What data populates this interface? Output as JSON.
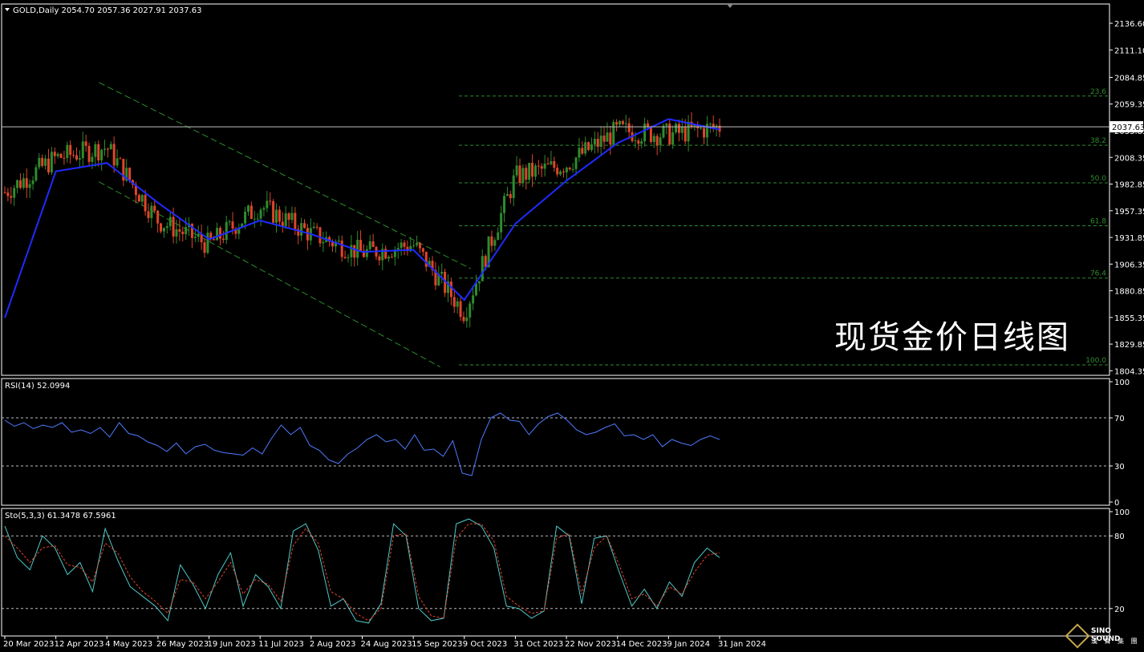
{
  "symbol_header": "GOLD,Daily  2054.70 2057.36 2027.91 2037.63",
  "current_price_label": "2037.63",
  "watermark": "现货金价日线图",
  "logo": {
    "name": "SINO SOUND",
    "sub": "漢 聲 集 團"
  },
  "rsi_header": "RSI(14) 52.0994",
  "sto_header": "Sto(5,3,3) 61.3478 67.5961",
  "chart_data": [
    {
      "type": "candlestick",
      "ylim": [
        1800,
        2155
      ],
      "y_ticks": [
        "2136.60",
        "2111.10",
        "2084.85",
        "2059.35",
        "2033.85",
        "2008.35",
        "1982.85",
        "1957.35",
        "1931.85",
        "1906.35",
        "1880.85",
        "1855.35",
        "1829.85",
        "1804.35"
      ],
      "x_ticks": [
        "20 Mar 2023",
        "12 Apr 2023",
        "4 May 2023",
        "26 May 2023",
        "19 Jun 2023",
        "11 Jul 2023",
        "2 Aug 2023",
        "24 Aug 2023",
        "15 Sep 2023",
        "9 Oct 2023",
        "31 Oct 2023",
        "22 Nov 2023",
        "14 Dec 2023",
        "9 Jan 2024",
        "31 Jan 2024"
      ],
      "close_path": [
        [
          "20 Mar 2023",
          1975
        ],
        [
          "12 Apr 2023",
          2008
        ],
        [
          "4 May 2023",
          2018
        ],
        [
          "26 May 2023",
          1948
        ],
        [
          "19 Jun 2023",
          1925
        ],
        [
          "11 Jul 2023",
          1962
        ],
        [
          "2 Aug 2023",
          1935
        ],
        [
          "24 Aug 2023",
          1917
        ],
        [
          "15 Sep 2023",
          1925
        ],
        [
          "9 Oct 2023",
          1860
        ],
        [
          "31 Oct 2023",
          1990
        ],
        [
          "22 Nov 2023",
          2002
        ],
        [
          "14 Dec 2023",
          2034
        ],
        [
          "9 Jan 2024",
          2030
        ],
        [
          "31 Jan 2024",
          2037.63
        ]
      ],
      "ma_path": [
        [
          "20 Mar 2023",
          1855
        ],
        [
          "12 Apr 2023",
          1995
        ],
        [
          "4 May 2023",
          2003
        ],
        [
          "26 May 2023",
          1965
        ],
        [
          "19 Jun 2023",
          1930
        ],
        [
          "11 Jul 2023",
          1948
        ],
        [
          "2 Aug 2023",
          1935
        ],
        [
          "24 Aug 2023",
          1918
        ],
        [
          "15 Sep 2023",
          1920
        ],
        [
          "9 Oct 2023",
          1872
        ],
        [
          "31 Oct 2023",
          1945
        ],
        [
          "22 Nov 2023",
          1986
        ],
        [
          "14 Dec 2023",
          2022
        ],
        [
          "9 Jan 2024",
          2045
        ],
        [
          "31 Jan 2024",
          2035
        ]
      ],
      "fib_levels": [
        {
          "label": "23.6",
          "price": 2067
        },
        {
          "label": "38.2",
          "price": 2020
        },
        {
          "label": "50.0",
          "price": 1984
        },
        {
          "label": "61.8",
          "price": 1943
        },
        {
          "label": "76.4",
          "price": 1893
        },
        {
          "label": "100.0",
          "price": 1810
        }
      ],
      "colors": {
        "up": "#2e8b2e",
        "down": "#e0452a",
        "ma": "#1f2bff",
        "fib": "#2e8b2e",
        "channel": "#2e8b2e",
        "grid": "#ffffff"
      }
    },
    {
      "type": "line",
      "name": "RSI(14)",
      "ylim": [
        0,
        100
      ],
      "y_ticks": [
        "100",
        "70",
        "30",
        "0"
      ],
      "levels": [
        70,
        30
      ],
      "values": [
        68,
        63,
        66,
        61,
        64,
        62,
        66,
        58,
        60,
        57,
        62,
        54,
        66,
        57,
        55,
        50,
        47,
        42,
        49,
        40,
        46,
        48,
        43,
        41,
        40,
        39,
        45,
        40,
        53,
        64,
        56,
        62,
        47,
        43,
        35,
        32,
        40,
        45,
        52,
        56,
        50,
        52,
        44,
        56,
        43,
        44,
        38,
        51,
        24,
        22,
        52,
        70,
        74,
        68,
        67,
        56,
        65,
        71,
        74,
        68,
        60,
        56,
        58,
        62,
        65,
        55,
        56,
        52,
        56,
        46,
        52,
        49,
        47,
        52,
        55,
        52
      ],
      "color": "#4f7bff"
    },
    {
      "type": "line",
      "name": "Sto(5,3,3)",
      "ylim": [
        0,
        100
      ],
      "y_ticks": [
        "100",
        "80",
        "20"
      ],
      "levels": [
        80,
        20
      ],
      "series": [
        {
          "values": [
            88,
            62,
            52,
            80,
            70,
            48,
            58,
            34,
            86,
            60,
            38,
            30,
            22,
            10,
            56,
            40,
            20,
            48,
            66,
            22,
            48,
            38,
            20,
            84,
            90,
            68,
            22,
            28,
            10,
            8,
            24,
            90,
            80,
            20,
            10,
            12,
            90,
            94,
            88,
            70,
            22,
            20,
            12,
            18,
            88,
            80,
            24,
            78,
            80,
            50,
            22,
            36,
            20,
            42,
            30,
            58,
            70,
            62
          ],
          "color": "#4fc9c9"
        },
        {
          "values": [
            80,
            70,
            58,
            70,
            72,
            56,
            54,
            42,
            74,
            66,
            46,
            34,
            26,
            16,
            44,
            42,
            28,
            42,
            58,
            32,
            44,
            40,
            26,
            72,
            86,
            74,
            34,
            28,
            16,
            10,
            20,
            80,
            82,
            30,
            14,
            12,
            78,
            90,
            90,
            76,
            30,
            22,
            16,
            18,
            78,
            82,
            32,
            70,
            80,
            56,
            28,
            32,
            22,
            38,
            32,
            50,
            64,
            66
          ],
          "color": "#e0452a"
        }
      ]
    }
  ]
}
